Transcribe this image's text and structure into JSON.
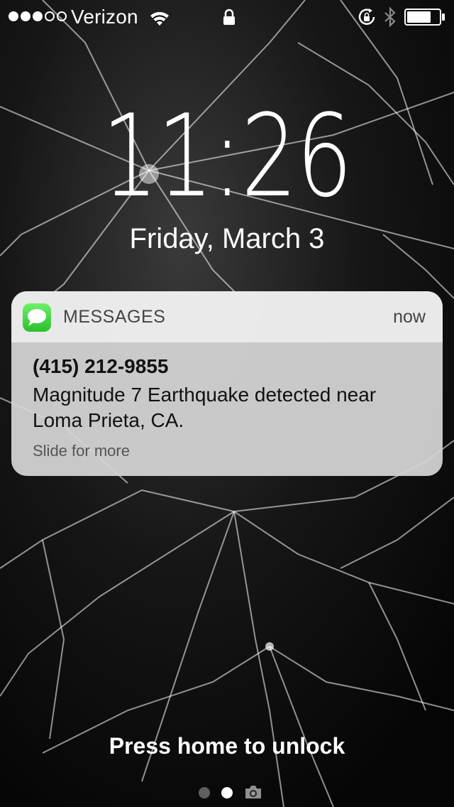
{
  "status_bar": {
    "carrier": "Verizon",
    "signal_bars_filled": 3,
    "signal_bars_total": 5,
    "icons": [
      "wifi-icon",
      "lock-icon",
      "rotation-lock-icon",
      "bluetooth-icon",
      "battery-icon"
    ],
    "battery_level": 0.75
  },
  "lock_screen": {
    "time": "11:26",
    "date": "Friday, March 3"
  },
  "notification": {
    "app_name": "MESSAGES",
    "app_icon": "messages-app-icon",
    "time": "now",
    "sender": "(415) 212-9855",
    "message": "Magnitude 7 Earthquake detected near Loma Prieta, CA.",
    "action_hint": "Slide for more"
  },
  "bottom": {
    "unlock_hint": "Press home to unlock",
    "page_indicator_count": 2,
    "page_indicator_active": 2,
    "camera_icon": "camera-icon"
  },
  "colors": {
    "background": "#0b0b0b",
    "messages_green": "#34c759",
    "notification_bg": "#d6d6d6"
  }
}
